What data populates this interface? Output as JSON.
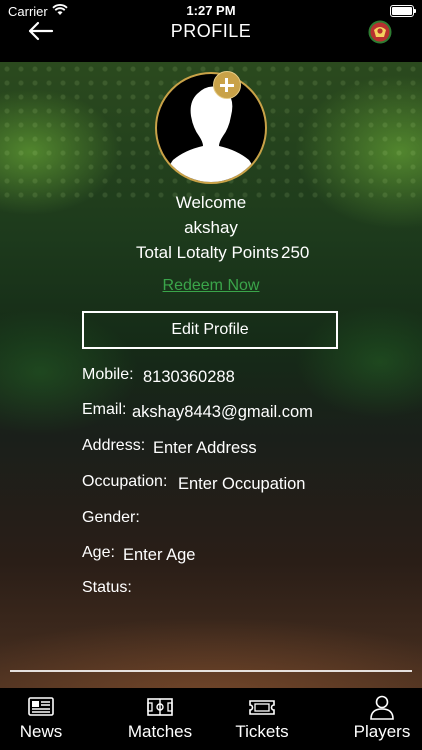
{
  "status_bar": {
    "carrier": "Carrier",
    "time": "1:27 PM"
  },
  "header": {
    "title": "PROFILE"
  },
  "profile": {
    "welcome": "Welcome",
    "username": "akshay",
    "points_label": "Total Lotalty Points",
    "points_value": "250",
    "redeem_label": "Redeem Now",
    "edit_label": "Edit Profile"
  },
  "fields": [
    {
      "label": "Mobile:",
      "value": "8130360288"
    },
    {
      "label": "Email:",
      "value": "akshay8443@gmail.com"
    },
    {
      "label": "Address:",
      "value": "Enter Address"
    },
    {
      "label": "Occupation:",
      "value": "Enter Occupation"
    },
    {
      "label": "Gender:",
      "value": ""
    },
    {
      "label": "Age:",
      "value": "Enter Age"
    },
    {
      "label": "Status:",
      "value": ""
    }
  ],
  "tabs": [
    {
      "label": "News",
      "icon": "newspaper-icon"
    },
    {
      "label": "Matches",
      "icon": "pitch-icon"
    },
    {
      "label": "Tickets",
      "icon": "ticket-icon"
    },
    {
      "label": "Players",
      "icon": "person-icon"
    }
  ],
  "colors": {
    "accent_gold": "#c9a248",
    "link_green": "#3aa54a",
    "background": "#000000"
  }
}
